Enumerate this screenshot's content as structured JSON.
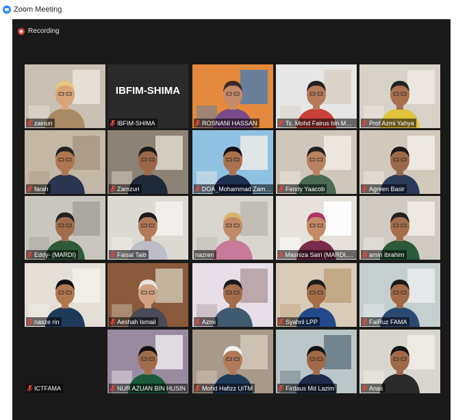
{
  "window": {
    "title": "Zoom Meeting"
  },
  "recording": {
    "label": "Recording"
  },
  "colors": {
    "stage": "#1a1a1a",
    "mic_muted": "#e0473d",
    "active_speaker": "#b7e04a",
    "zoom_blue": "#2d8cff"
  },
  "participants": [
    {
      "name": "zainun",
      "muted": true
    },
    {
      "name": "IBFIM-SHIMA",
      "muted": true,
      "banner": "IBFIM-SHIMA"
    },
    {
      "name": "ROSNANI HASSAN",
      "muted": true
    },
    {
      "name": "Ts. Mohd Fairus bin Moh...",
      "muted": true
    },
    {
      "name": "Prof Azmi Yahya",
      "muted": true
    },
    {
      "name": "farah",
      "muted": true
    },
    {
      "name": "Zamzuri",
      "muted": true
    },
    {
      "name": "DOA_Mohammad Zamani",
      "muted": true
    },
    {
      "name": "Fendy Yaacob",
      "muted": true
    },
    {
      "name": "Agreen Basir",
      "muted": true
    },
    {
      "name": "Eddy- (MARDI)",
      "muted": true
    },
    {
      "name": "Faisal Taib",
      "muted": true
    },
    {
      "name": "nazren",
      "muted": false,
      "active": true
    },
    {
      "name": "Masniza Sairi (MARDI, M...",
      "muted": true
    },
    {
      "name": "amin ibrahim",
      "muted": true
    },
    {
      "name": "nasze rin",
      "muted": true
    },
    {
      "name": "Aeshah Ismail",
      "muted": true
    },
    {
      "name": "Azmi",
      "muted": true
    },
    {
      "name": "Syahril LPP",
      "muted": true
    },
    {
      "name": "FaiRuz FAMA",
      "muted": true
    },
    {
      "name": "ICTFAMA",
      "muted": true
    },
    {
      "name": "NUR AZUAN BIN HUSIN",
      "muted": true
    },
    {
      "name": "Mohd Hafizz UiTM",
      "muted": true
    },
    {
      "name": "Firdaus Md Lazim",
      "muted": true
    },
    {
      "name": "Anas",
      "muted": true
    }
  ]
}
